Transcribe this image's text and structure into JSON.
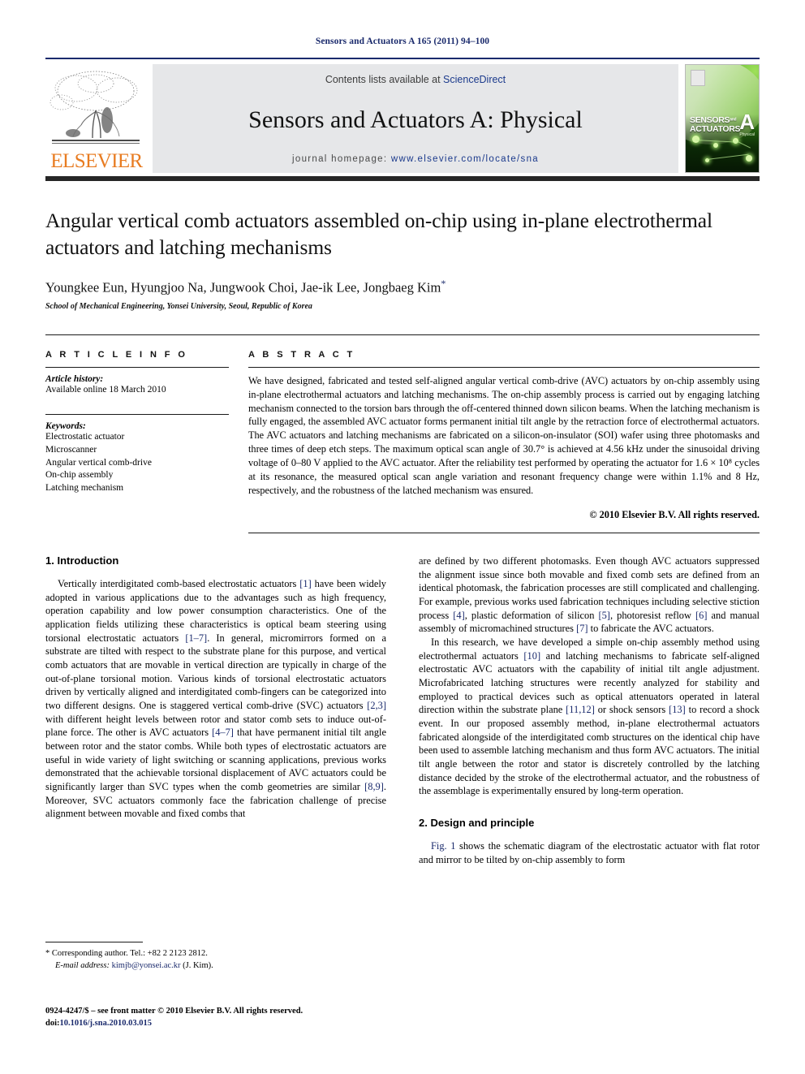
{
  "running_head": "Sensors and Actuators A 165 (2011) 94–100",
  "masthead": {
    "contents_prefix": "Contents lists available at ",
    "sciencedirect": "ScienceDirect",
    "journal_title": "Sensors and Actuators A: Physical",
    "homepage_prefix": "journal homepage: ",
    "homepage_url": "www.elsevier.com/locate/sna",
    "publisher_logo_text": "ELSEVIER",
    "cover": {
      "line1": "SENSORS",
      "and": "and",
      "line2": "ACTUATORS",
      "letter": "A",
      "subtitle": "Physical"
    },
    "colors": {
      "rule": "#1a2a6c",
      "panel": "#e6e7e9",
      "link": "#1b3a8c",
      "elsevier_orange": "#E87C22"
    }
  },
  "article": {
    "title": "Angular vertical comb actuators assembled on-chip using in-plane electrothermal actuators and latching mechanisms",
    "authors": "Youngkee Eun, Hyungjoo Na, Jungwook Choi, Jae-ik Lee, Jongbaeg Kim",
    "author_marker": "*",
    "affiliation": "School of Mechanical Engineering, Yonsei University, Seoul, Republic of Korea"
  },
  "article_info": {
    "heading": "A R T I C L E   I N F O",
    "history_label": "Article history:",
    "history_value": "Available online 18 March 2010",
    "keywords_label": "Keywords:",
    "keywords": [
      "Electrostatic actuator",
      "Microscanner",
      "Angular vertical comb-drive",
      "On-chip assembly",
      "Latching mechanism"
    ]
  },
  "abstract": {
    "heading": "A B S T R A C T",
    "text": "We have designed, fabricated and tested self-aligned angular vertical comb-drive (AVC) actuators by on-chip assembly using in-plane electrothermal actuators and latching mechanisms. The on-chip assembly process is carried out by engaging latching mechanism connected to the torsion bars through the off-centered thinned down silicon beams. When the latching mechanism is fully engaged, the assembled AVC actuator forms permanent initial tilt angle by the retraction force of electrothermal actuators. The AVC actuators and latching mechanisms are fabricated on a silicon-on-insulator (SOI) wafer using three photomasks and three times of deep etch steps. The maximum optical scan angle of 30.7° is achieved at 4.56 kHz under the sinusoidal driving voltage of 0–80 V applied to the AVC actuator. After the reliability test performed by operating the actuator for 1.6 × 10⁸ cycles at its resonance, the measured optical scan angle variation and resonant frequency change were within 1.1% and 8 Hz, respectively, and the robustness of the latched mechanism was ensured.",
    "copyright": "© 2010 Elsevier B.V. All rights reserved."
  },
  "sections": {
    "intro_heading": "1.  Introduction",
    "design_heading": "2.  Design and principle"
  },
  "left_column": {
    "p1_a": "Vertically interdigitated comb-based electrostatic actuators ",
    "p1_r1": "[1]",
    "p1_b": " have been widely adopted in various applications due to the advantages such as high frequency, operation capability and low power consumption characteristics. One of the application fields utilizing these characteristics is optical beam steering using torsional electrostatic actuators ",
    "p1_r2": "[1–7]",
    "p1_c": ". In general, micromirrors formed on a substrate are tilted with respect to the substrate plane for this purpose, and vertical comb actuators that are movable in vertical direction are typically in charge of the out-of-plane torsional motion. Various kinds of torsional electrostatic actuators driven by vertically aligned and interdigitated comb-fingers can be categorized into two different designs. One is staggered vertical comb-drive (SVC) actuators ",
    "p1_r3": "[2,3]",
    "p1_d": " with different height levels between rotor and stator comb sets to induce out-of-plane force. The other is AVC actuators ",
    "p1_r4": "[4–7]",
    "p1_e": " that have permanent initial tilt angle between rotor and the stator combs. While both types of electrostatic actuators are useful in wide variety of light switching or scanning applications, previous works demonstrated that the achievable torsional displacement of AVC actuators could be significantly larger than SVC types when the comb geometries are similar ",
    "p1_r5": "[8,9]",
    "p1_f": ". Moreover, SVC actuators commonly face the fabrication challenge of precise alignment between movable and fixed combs that"
  },
  "right_column": {
    "p1_a": "are defined by two different photomasks. Even though AVC actuators suppressed the alignment issue since both movable and fixed comb sets are defined from an identical photomask, the fabrication processes are still complicated and challenging. For example, previous works used fabrication techniques including selective stiction process ",
    "p1_r1": "[4]",
    "p1_b": ", plastic deformation of silicon ",
    "p1_r2": "[5]",
    "p1_c": ", photoresist reflow ",
    "p1_r3": "[6]",
    "p1_d": " and manual assembly of micromachined structures ",
    "p1_r4": "[7]",
    "p1_e": " to fabricate the AVC actuators.",
    "p2_a": "In this research, we have developed a simple on-chip assembly method using electrothermal actuators ",
    "p2_r1": "[10]",
    "p2_b": " and latching mechanisms to fabricate self-aligned electrostatic AVC actuators with the capability of initial tilt angle adjustment. Microfabricated latching structures were recently analyzed for stability and employed to practical devices such as optical attenuators operated in lateral direction within the substrate plane ",
    "p2_r2": "[11,12]",
    "p2_c": " or shock sensors ",
    "p2_r3": "[13]",
    "p2_d": " to record a shock event. In our proposed assembly method, in-plane electrothermal actuators fabricated alongside of the interdigitated comb structures on the identical chip have been used to assemble latching mechanism and thus form AVC actuators. The initial tilt angle between the rotor and stator is discretely controlled by the latching distance decided by the stroke of the electrothermal actuator, and the robustness of the assemblage is experimentally ensured by long-term operation.",
    "p3_r1": "Fig. 1",
    "p3_a": " shows the schematic diagram of the electrostatic actuator with flat rotor and mirror to be tilted by on-chip assembly to form"
  },
  "footnotes": {
    "corresponding": "* Corresponding author. Tel.: +82 2 2123 2812.",
    "email_label": "E-mail address:",
    "email": "kimjb@yonsei.ac.kr",
    "email_suffix": "(J. Kim).",
    "front_matter": "0924-4247/$ – see front matter © 2010 Elsevier B.V. All rights reserved.",
    "doi_label": "doi:",
    "doi": "10.1016/j.sna.2010.03.015"
  }
}
